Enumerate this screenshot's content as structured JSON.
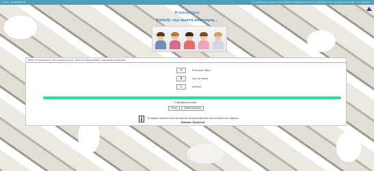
{
  "topbar": {
    "left": "ταλέρ... Εκπαιδευτικά",
    "right": "Το ανοιγόμενο παράθυρο είναι σύμφωνο Συμβουλευτικό πιστού εφαρμογή είναι για ορθή λειτουργία του παραθύρου"
  },
  "header": {
    "title": "Η οικογένεια",
    "subtitle": "Επέλεξε την σωστή απάντηση..."
  },
  "question": {
    "text": "Βάλε τις προτάσεις στη σωστή σειρά, ώστε να σχηματίσουν μια σωστή πρόταση."
  },
  "options": [
    {
      "letter": "A",
      "label": "Ελληνικό, Μαρί"
    },
    {
      "letter": "B",
      "label": "Σας το λασία"
    },
    {
      "letter": "C",
      "label": "ματάτα"
    }
  ],
  "progress": {
    "value": 1.0,
    "color": "#36d79e"
  },
  "grade": {
    "label": "Η βαθμολογία σου:"
  },
  "buttons": {
    "check": "Τελικ",
    "retry": "Επανεκκίνηση"
  },
  "footer": {
    "line1": "Το παρόν εκπαιδευτικό λογισμικό κατασκευάστηκε στα πλαίσια του Σχολών",
    "line2": "Φορμών Εργαλεία"
  },
  "colors": {
    "topbar": "#4f9fb6",
    "accent": "#3e8fe0",
    "progress": "#36d79e"
  },
  "icons": {
    "scroll": "arrow-up-icon",
    "info": "info-icon"
  }
}
